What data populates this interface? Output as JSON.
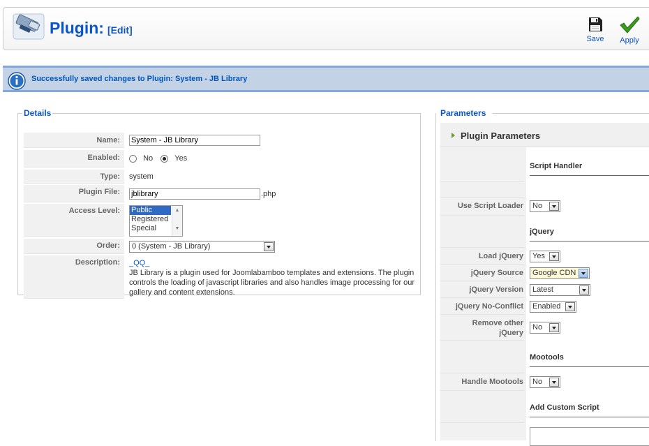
{
  "header": {
    "title": "Plugin:",
    "subtitle": "[Edit]"
  },
  "toolbar": {
    "save_label": "Save",
    "apply_label": "Apply"
  },
  "message": {
    "text": "Successfully saved changes to Plugin: System - JB Library"
  },
  "details": {
    "legend": "Details",
    "name_label": "Name:",
    "name_value": "System - JB Library",
    "enabled_label": "Enabled:",
    "enabled_no": "No",
    "enabled_yes": "Yes",
    "enabled_selected": "Yes",
    "type_label": "Type:",
    "type_value": "system",
    "file_label": "Plugin File:",
    "file_value": "jblibrary",
    "file_ext": ".php",
    "access_label": "Access Level:",
    "access_options": [
      "Public",
      "Registered",
      "Special"
    ],
    "access_selected": "Public",
    "order_label": "Order:",
    "order_value": "0 (System - JB Library)",
    "desc_label": "Description:",
    "desc_link": "_QQ_",
    "desc_text": "JB Library is a plugin used for Joomlabamboo templates and extensions. The plugin controls the loading of javascript libraries and also handles image processing for our gallery and content extensions."
  },
  "params": {
    "legend": "Parameters",
    "panel_title": "Plugin Parameters",
    "sections": {
      "script_handler": "Script Handler",
      "jquery": "jQuery",
      "mootools": "Mootools",
      "custom": "Add Custom Script"
    },
    "use_loader_label": "Use Script Loader",
    "use_loader_value": "No",
    "load_jquery_label": "Load jQuery",
    "load_jquery_value": "Yes",
    "jquery_source_label": "jQuery Source",
    "jquery_source_value": "Google CDN",
    "jquery_version_label": "jQuery Version",
    "jquery_version_value": "Latest",
    "noconflict_label": "jQuery No-Conflict",
    "noconflict_value": "Enabled",
    "remove_other_label_1": "Remove other",
    "remove_other_label_2": "jQuery",
    "remove_other_value": "No",
    "handle_mootools_label": "Handle Mootools",
    "handle_mootools_value": "No"
  },
  "colors": {
    "accent": "#0b55c4",
    "message_bg": "#c3d2e5",
    "apply_green": "#3a9a1c"
  }
}
